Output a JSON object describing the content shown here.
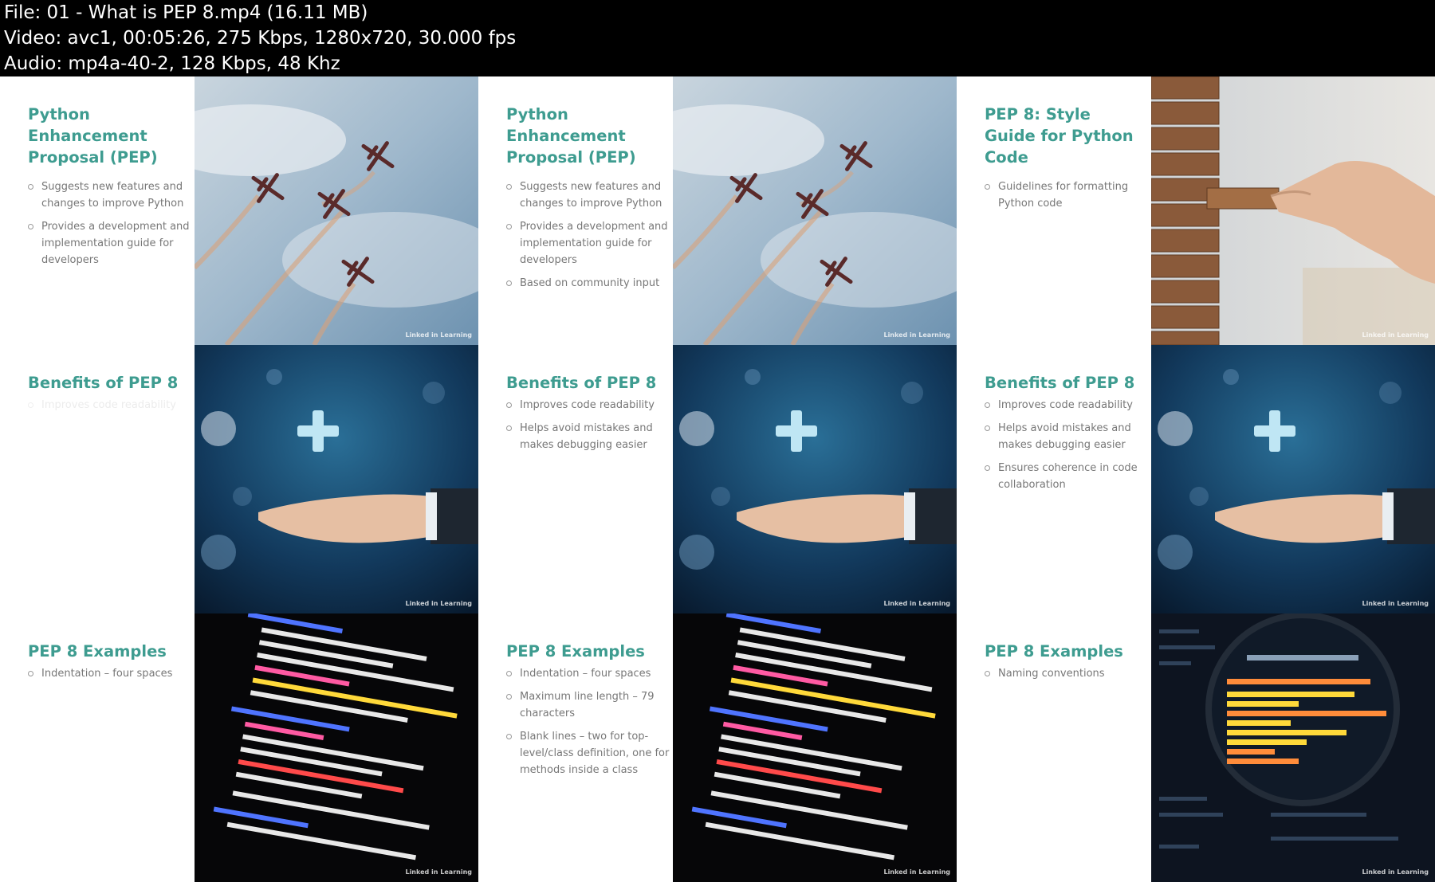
{
  "header": {
    "file": "File: 01 - What is PEP 8.mp4 (16.11 MB)",
    "video": "Video: avc1, 00:05:26, 275 Kbps, 1280x720, 30.000 fps",
    "audio": "Audio: mp4a-40-2, 128 Kbps, 48 Khz"
  },
  "colors": {
    "accent": "#3e9c90",
    "bullet_text": "#777777"
  },
  "watermark": "Linked in Learning",
  "tiles": [
    {
      "title": "Python Enhancement Proposal (PEP)",
      "bullets": [
        "Suggests new features and changes to improve Python",
        "Provides a development and implementation guide for developers"
      ],
      "image": "airplanes-photo"
    },
    {
      "title": "Python Enhancement Proposal (PEP)",
      "bullets": [
        "Suggests new features and changes to improve Python",
        "Provides a development and implementation guide for developers",
        "Based on community input"
      ],
      "image": "airplanes-photo"
    },
    {
      "title": "PEP 8: Style Guide for Python Code",
      "bullets": [
        "Guidelines for formatting Python code"
      ],
      "image": "wooden-blocks-photo"
    },
    {
      "title": "Benefits of PEP 8",
      "bullets": [
        "Improves code readability"
      ],
      "image": "hand-plus-photo"
    },
    {
      "title": "Benefits of PEP 8",
      "bullets": [
        "Improves code readability",
        "Helps avoid mistakes and makes debugging easier"
      ],
      "image": "hand-plus-photo"
    },
    {
      "title": "Benefits of PEP 8",
      "bullets": [
        "Improves code readability",
        "Helps avoid mistakes and makes debugging easier",
        "Ensures coherence in code collaboration"
      ],
      "image": "hand-plus-photo"
    },
    {
      "title": "PEP 8 Examples",
      "bullets": [
        "Indentation – four spaces"
      ],
      "image": "code-screen-photo"
    },
    {
      "title": "PEP 8 Examples",
      "bullets": [
        "Indentation – four spaces",
        "Maximum line length – 79 characters",
        "Blank lines – two for top-level/class definition, one for methods inside a class"
      ],
      "image": "code-screen-photo"
    },
    {
      "title": "PEP 8 Examples",
      "bullets": [
        "Naming conventions"
      ],
      "image": "magnifier-code-photo"
    }
  ]
}
